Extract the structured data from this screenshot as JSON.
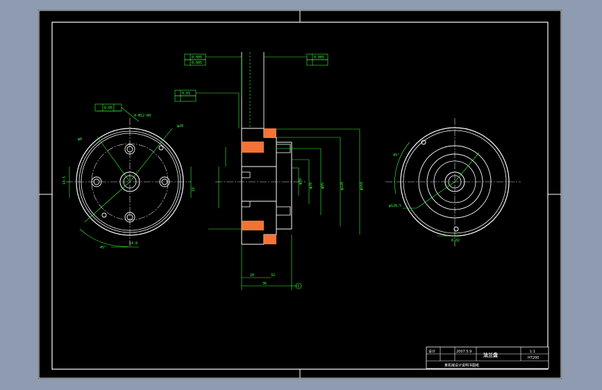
{
  "colors": {
    "background": "#8e9bb0",
    "paper": "#000000",
    "frame": "#ffffff",
    "geometry": "#ffffff",
    "dimension": "#3cff3c",
    "hatch": "#ff7a3c",
    "centerline": "#e0e0e0"
  },
  "left_view": {
    "labels": {
      "bolt_circle": "4-M12-6H",
      "dia_a": "φ28",
      "dia_b": "φ8",
      "dim_left": "14.5",
      "dim_right": "18",
      "dim_bot": "14.8",
      "angle": "45°",
      "gtol_val": "0.05"
    }
  },
  "section_view": {
    "gtol_1": "0.005",
    "gtol_2": "0.005",
    "gtol_3": "0.005",
    "gtol_4": "0.01",
    "dims": {
      "d1": "φ38",
      "d2": "φ70",
      "d3": "φ95",
      "d4": "φ120",
      "d5": "φ168",
      "len_a": "20",
      "len_b": "32",
      "total": "36"
    },
    "balloon": "1"
  },
  "right_view": {
    "labels": {
      "angle_r": "45°",
      "dia_r": "φ128.5",
      "tol_r": "0.02"
    }
  },
  "title_block": {
    "drawn_by": "设计",
    "date": "2007.5.9",
    "part_name": "法兰盘",
    "scale": "1:1",
    "material": "HT200",
    "project": "某机械设计说明书图纸"
  }
}
